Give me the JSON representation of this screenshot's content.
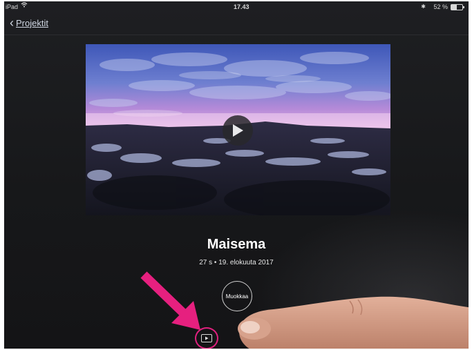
{
  "status_bar": {
    "device": "iPad",
    "time": "17.43",
    "battery": "52 %"
  },
  "nav": {
    "back_label": "Projektit"
  },
  "project": {
    "title": "Maisema",
    "meta": "27 s • 19. elokuuta 2017",
    "edit_label": "Muokkaa"
  },
  "icons": {
    "back": "chevron-left-icon",
    "play": "play-icon",
    "bottom_play": "play-square-icon",
    "wifi": "wifi-icon",
    "bluetooth": "bluetooth-icon",
    "battery": "battery-icon"
  },
  "colors": {
    "annotation_arrow": "#e6207f",
    "highlight_circle": "#e0207e",
    "background": "#1a1b1d"
  }
}
